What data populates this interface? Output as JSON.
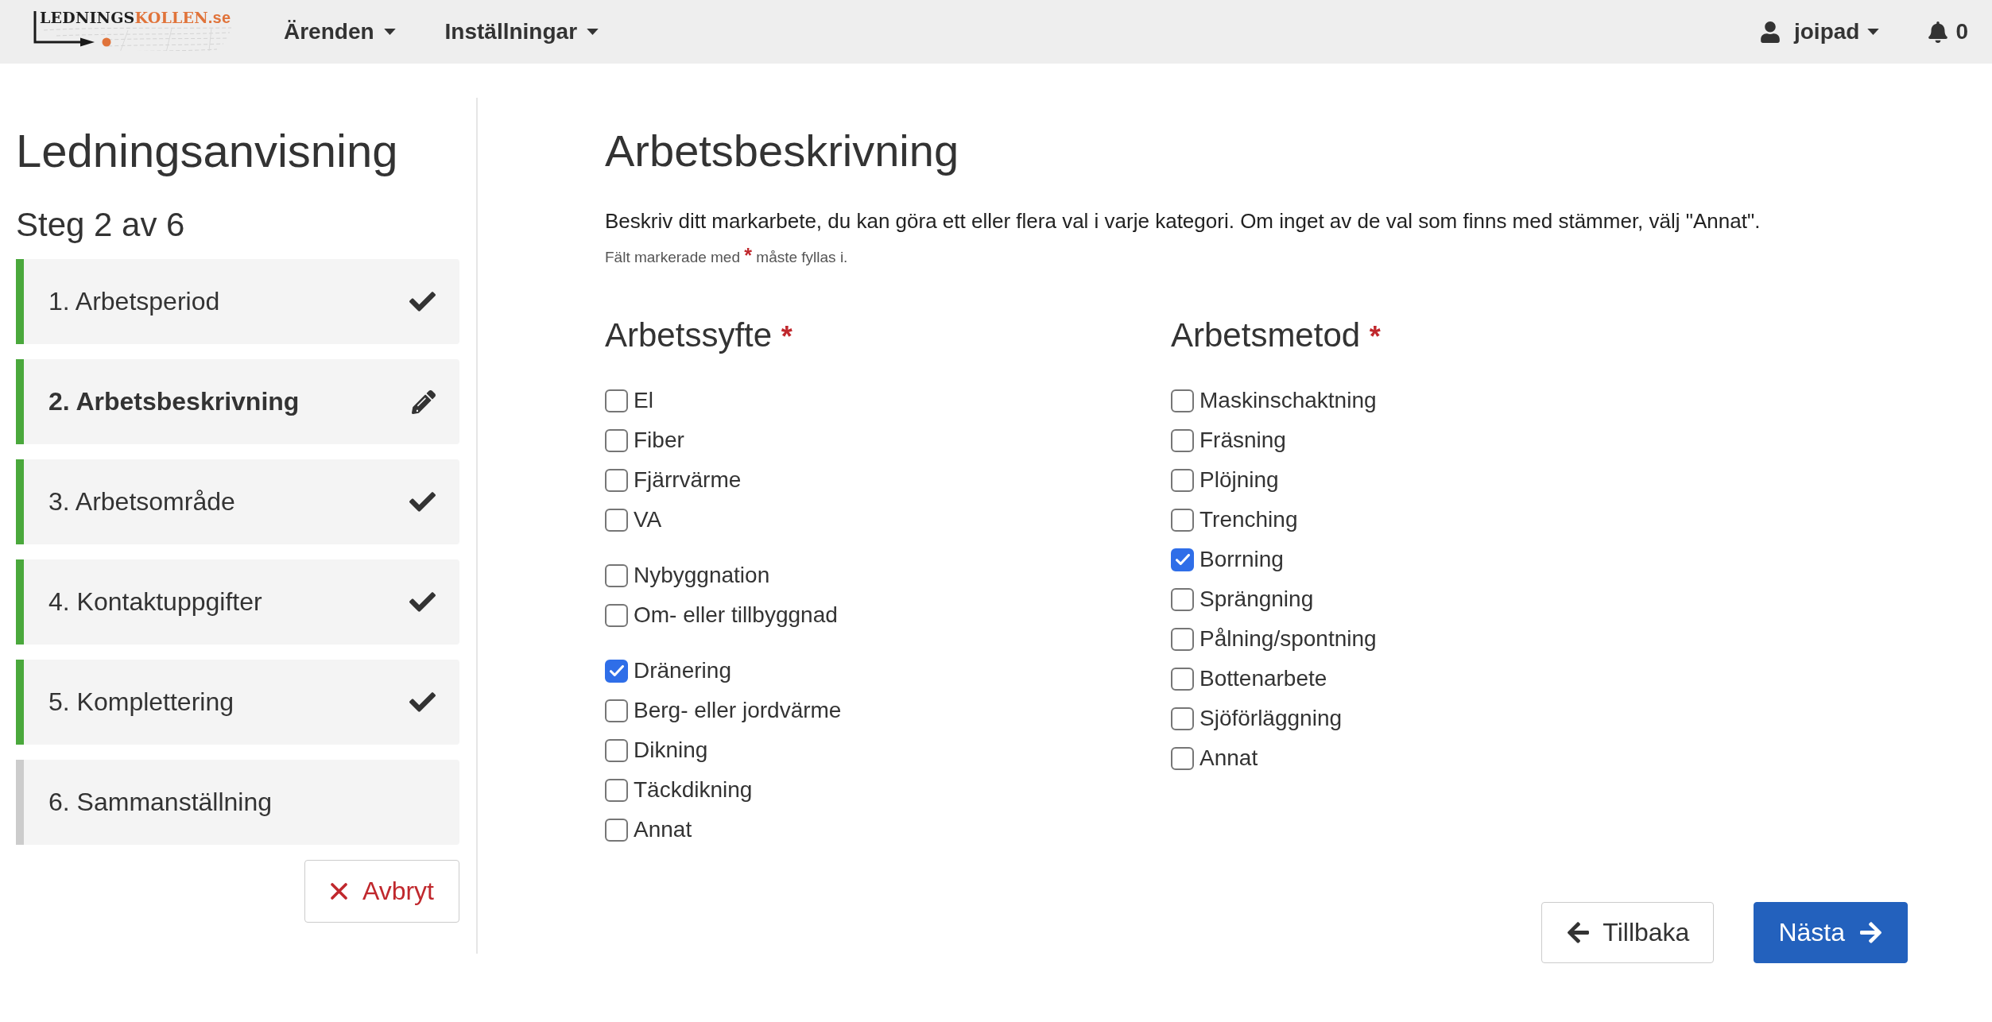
{
  "navbar": {
    "logo": {
      "primary": "LEDNINGS",
      "accent": "KOLLEN",
      "domain": ".se"
    },
    "menus": [
      {
        "label": "Ärenden"
      },
      {
        "label": "Inställningar"
      }
    ],
    "user_menu": {
      "label": "joipad"
    },
    "notifications": {
      "count": "0"
    }
  },
  "sidebar": {
    "title": "Ledningsanvisning",
    "step_counter": "Steg 2 av 6",
    "steps": [
      {
        "label": "1. Arbetsperiod",
        "completed": true,
        "selected": false
      },
      {
        "label": "2. Arbetsbeskrivning",
        "completed": true,
        "selected": true
      },
      {
        "label": "3. Arbetsområde",
        "completed": true,
        "selected": false
      },
      {
        "label": "4. Kontaktuppgifter",
        "completed": true,
        "selected": false
      },
      {
        "label": "5. Komplettering",
        "completed": true,
        "selected": false
      },
      {
        "label": "6. Sammanställning",
        "completed": false,
        "selected": false
      }
    ],
    "cancel_button": {
      "label": "Avbryt"
    }
  },
  "form": {
    "title": "Arbetsbeskrivning",
    "description": "Beskriv ditt markarbete, du kan göra ett eller flera val i varje kategori. Om inget av de val som finns med stämmer, välj \"Annat\".",
    "required_note": {
      "text_before": "Fält markerade med",
      "mark": "*",
      "text_after": "måste fyllas i."
    },
    "sections": [
      {
        "title": "Arbetssyfte",
        "required_mark": "*",
        "groups": [
          {
            "options": [
              {
                "label": "El",
                "checked": false
              },
              {
                "label": "Fiber",
                "checked": false
              },
              {
                "label": "Fjärrvärme",
                "checked": false
              },
              {
                "label": "VA",
                "checked": false
              }
            ]
          },
          {
            "options": [
              {
                "label": "Nybyggnation",
                "checked": false
              },
              {
                "label": "Om- eller tillbyggnad",
                "checked": false
              }
            ]
          },
          {
            "options": [
              {
                "label": "Dränering",
                "checked": true
              },
              {
                "label": "Berg- eller jordvärme",
                "checked": false
              },
              {
                "label": "Dikning",
                "checked": false
              },
              {
                "label": "Täckdikning",
                "checked": false
              },
              {
                "label": "Annat",
                "checked": false
              }
            ]
          }
        ]
      },
      {
        "title": "Arbetsmetod",
        "required_mark": "*",
        "groups": [
          {
            "options": [
              {
                "label": "Maskinschaktning",
                "checked": false
              },
              {
                "label": "Fräsning",
                "checked": false
              },
              {
                "label": "Plöjning",
                "checked": false
              },
              {
                "label": "Trenching",
                "checked": false
              },
              {
                "label": "Borrning",
                "checked": true
              },
              {
                "label": "Sprängning",
                "checked": false
              },
              {
                "label": "Pålning/spontning",
                "checked": false
              },
              {
                "label": "Bottenarbete",
                "checked": false
              },
              {
                "label": "Sjöförläggning",
                "checked": false
              },
              {
                "label": "Annat",
                "checked": false
              }
            ]
          }
        ]
      }
    ],
    "navigation_buttons": [
      {
        "kind": "back",
        "label": "Tillbaka"
      },
      {
        "kind": "next",
        "label": "Nästa"
      }
    ]
  }
}
